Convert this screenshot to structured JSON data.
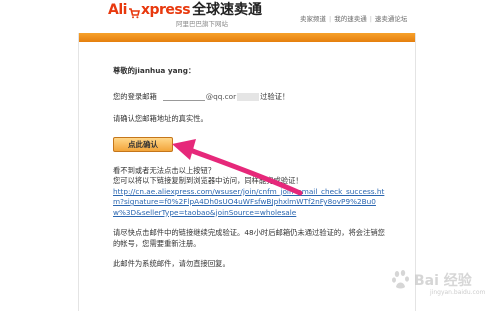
{
  "header": {
    "logo_ali": "Ali",
    "logo_express": "xpress",
    "logo_cn": "全球速卖通",
    "logo_sub": "阿里巴巴旗下网站",
    "nav": [
      "卖家频道",
      "我的速卖通",
      "速卖通论坛"
    ]
  },
  "email": {
    "greeting": "尊敬的jianhua yang：",
    "mail_prefix": "您的登录邮箱",
    "mail_domain": "@qq.cor",
    "mail_suffix": "过验证！",
    "confirm_text": "请确认您邮箱地址的真实性。",
    "button_label": "点此确认",
    "fallback_1": "看不到或者无法点击以上按钮？",
    "fallback_2": "您可以将以下链接复制到浏览器中访问，同样能完成验证！",
    "link": "http://cn.ae.aliexpress.com/wsuser/join/cnfm_join_email_check_success.htm?signature=f0%2FlpA4Dh0sUO4uWFsfwBJphxlmWTf2nFy8ovP9%2Bu0w%3D&sellerType=taobao&joinSource=wholesale",
    "notice": "请尽快点击邮件中的链接继续完成验证。48小时后邮箱仍未通过验证的，将会注销您的帐号，您需要重新注册。",
    "system": "此邮件为系统邮件，请勿直接回复。"
  },
  "watermark": {
    "text": "Bai 经验",
    "url": "jingyan.baidu.com"
  },
  "colors": {
    "brand": "#e8390e",
    "bar": "#f39a1e",
    "link": "#2a66b0",
    "arrow": "#e6287a"
  }
}
